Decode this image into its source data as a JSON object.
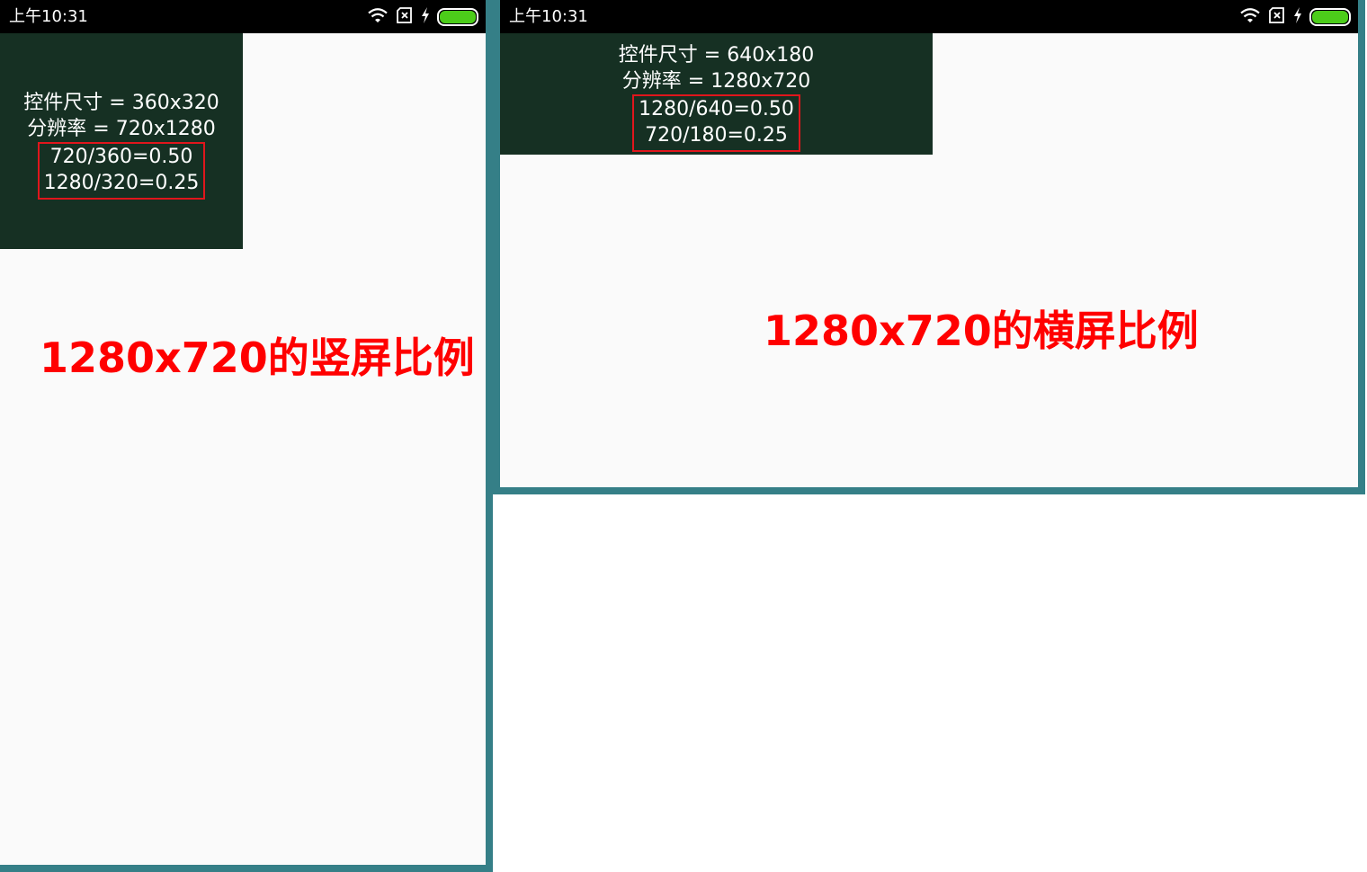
{
  "colors": {
    "panel_bg": "#163023",
    "frame_border": "#357f87",
    "highlight_box": "#e0161c",
    "caption": "#ff0000",
    "battery": "#4ccd1a"
  },
  "portrait": {
    "status_time": "上午10:31",
    "size_line": "控件尺寸 = 360x320",
    "resolution_line": "分辨率 = 720x1280",
    "ratio_x": "720/360=0.50",
    "ratio_y": "1280/320=0.25",
    "caption": "1280x720的竖屏比例"
  },
  "landscape": {
    "status_time": "上午10:31",
    "size_line": "控件尺寸 = 640x180",
    "resolution_line": "分辨率 = 1280x720",
    "ratio_x": "1280/640=0.50",
    "ratio_y": "720/180=0.25",
    "caption": "1280x720的横屏比例"
  },
  "status_icons": [
    "wifi-icon",
    "no-sim-icon",
    "charging-icon",
    "battery-icon"
  ]
}
